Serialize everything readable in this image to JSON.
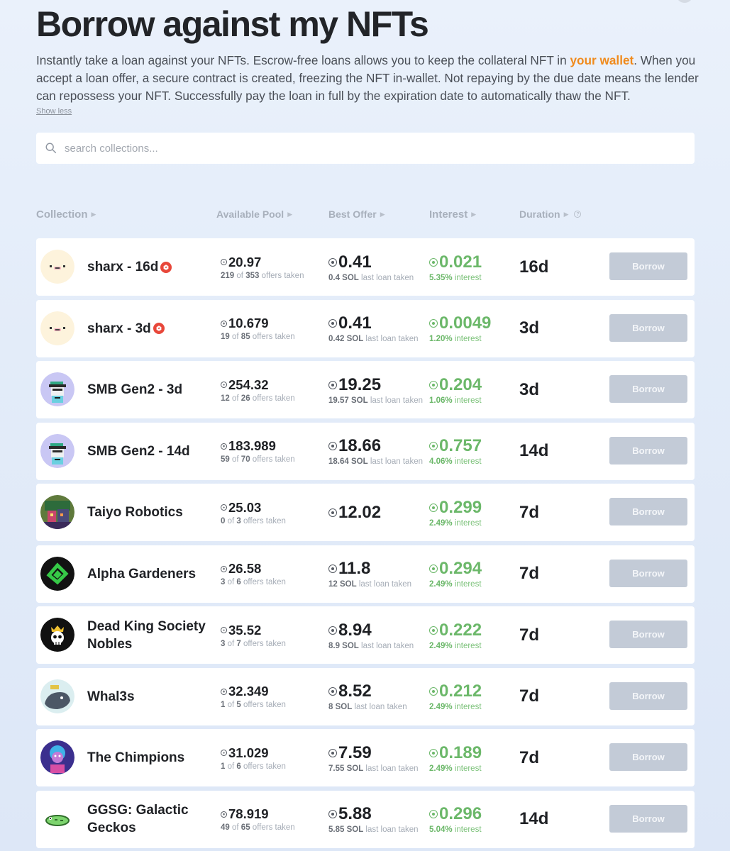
{
  "page": {
    "title": "Borrow against my NFTs",
    "intro_before": "Instantly take a loan against your NFTs. Escrow-free loans allows you to keep the collateral NFT in ",
    "intro_highlight": "your wallet",
    "intro_after": ". When you accept a loan offer, a secure contract is created, freezing the NFT in-wallet. Not repaying by the due date means the lender can repossess your NFT. Successfully pay the loan in full by the expiration date to automatically thaw the NFT.",
    "show_less": "Show less",
    "highlight_color": "#f08a1c"
  },
  "search": {
    "placeholder": "search collections...",
    "value": ""
  },
  "columns": {
    "collection": "Collection",
    "pool": "Available Pool",
    "offer": "Best Offer",
    "interest": "Interest",
    "duration": "Duration"
  },
  "rows": [
    {
      "name": "sharx - 16d",
      "badge": true,
      "avatar": "sharx-avatar",
      "pool": "20.97",
      "pool_taken": "219",
      "pool_total": "353",
      "offer": "0.41",
      "last_loan": "0.4 SOL",
      "interest": "0.021",
      "interest_pct": "5.35%",
      "duration": "16d",
      "button": "Borrow"
    },
    {
      "name": "sharx - 3d",
      "badge": true,
      "avatar": "sharx-avatar",
      "pool": "10.679",
      "pool_taken": "19",
      "pool_total": "85",
      "offer": "0.41",
      "last_loan": "0.42 SOL",
      "interest": "0.0049",
      "interest_pct": "1.20%",
      "duration": "3d",
      "button": "Borrow"
    },
    {
      "name": "SMB Gen2 - 3d",
      "badge": false,
      "avatar": "smb-avatar",
      "pool": "254.32",
      "pool_taken": "12",
      "pool_total": "26",
      "offer": "19.25",
      "last_loan": "19.57 SOL",
      "interest": "0.204",
      "interest_pct": "1.06%",
      "duration": "3d",
      "button": "Borrow"
    },
    {
      "name": "SMB Gen2 - 14d",
      "badge": false,
      "avatar": "smb-avatar",
      "pool": "183.989",
      "pool_taken": "59",
      "pool_total": "70",
      "offer": "18.66",
      "last_loan": "18.64 SOL",
      "interest": "0.757",
      "interest_pct": "4.06%",
      "duration": "14d",
      "button": "Borrow"
    },
    {
      "name": "Taiyo Robotics",
      "badge": false,
      "avatar": "taiyo-avatar",
      "pool": "25.03",
      "pool_taken": "0",
      "pool_total": "3",
      "offer": "12.02",
      "last_loan": "",
      "interest": "0.299",
      "interest_pct": "2.49%",
      "duration": "7d",
      "button": "Borrow"
    },
    {
      "name": "Alpha Gardeners",
      "badge": false,
      "avatar": "alpha-avatar",
      "pool": "26.58",
      "pool_taken": "3",
      "pool_total": "6",
      "offer": "11.8",
      "last_loan": "12 SOL",
      "interest": "0.294",
      "interest_pct": "2.49%",
      "duration": "7d",
      "button": "Borrow"
    },
    {
      "name": "Dead King Society Nobles",
      "badge": false,
      "avatar": "deadking-avatar",
      "pool": "35.52",
      "pool_taken": "3",
      "pool_total": "7",
      "offer": "8.94",
      "last_loan": "8.9 SOL",
      "interest": "0.222",
      "interest_pct": "2.49%",
      "duration": "7d",
      "button": "Borrow"
    },
    {
      "name": "Whal3s",
      "badge": false,
      "avatar": "whale-avatar",
      "pool": "32.349",
      "pool_taken": "1",
      "pool_total": "5",
      "offer": "8.52",
      "last_loan": "8 SOL",
      "interest": "0.212",
      "interest_pct": "2.49%",
      "duration": "7d",
      "button": "Borrow"
    },
    {
      "name": "The Chimpions",
      "badge": false,
      "avatar": "chimp-avatar",
      "pool": "31.029",
      "pool_taken": "1",
      "pool_total": "6",
      "offer": "7.59",
      "last_loan": "7.55 SOL",
      "interest": "0.189",
      "interest_pct": "2.49%",
      "duration": "7d",
      "button": "Borrow"
    },
    {
      "name": "GGSG: Galactic Geckos",
      "badge": false,
      "avatar": "gecko-avatar",
      "pool": "78.919",
      "pool_taken": "49",
      "pool_total": "65",
      "offer": "5.88",
      "last_loan": "5.85 SOL",
      "interest": "0.296",
      "interest_pct": "5.04%",
      "duration": "14d",
      "button": "Borrow"
    }
  ],
  "labels": {
    "of": "of",
    "offers_taken": "offers taken",
    "last_loan_taken": "last loan taken",
    "interest_suffix": "interest"
  },
  "colors": {
    "interest_green": "#6cb86a",
    "button_bg": "#c3cbd7",
    "badge_red": "#e8473a"
  }
}
